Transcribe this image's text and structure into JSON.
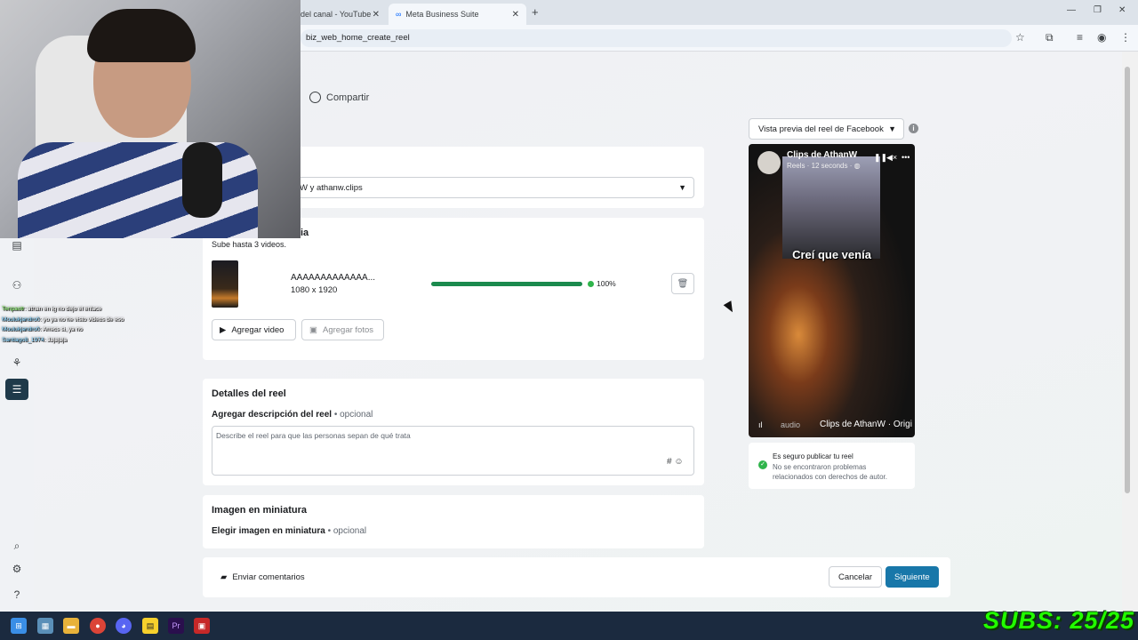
{
  "browser": {
    "tabs": [
      {
        "label": "del canal - YouTube",
        "active": false
      },
      {
        "label": "Meta Business Suite",
        "active": true
      }
    ],
    "url": "biz_web_home_create_reel"
  },
  "steps": {
    "share_label": "Compartir"
  },
  "account_select": {
    "value": "W y athanw.clips"
  },
  "media": {
    "title_fragment": "ia",
    "subtitle": "Sube hasta 3 videos.",
    "video": {
      "name": "AAAAAAAAAAAAA...",
      "dims": "1080 x 1920",
      "progress": 100,
      "progress_label": "100%"
    },
    "add_video_label": "Agregar video",
    "add_photos_label": "Agregar fotos"
  },
  "details": {
    "title": "Detalles del reel",
    "desc_label": "Agregar descripción del reel",
    "optional": "opcional",
    "desc_placeholder": "Describe el reel para que las personas sepan de qué trata"
  },
  "thumbnail": {
    "title": "Imagen en miniatura",
    "choose_label": "Elegir imagen en miniatura",
    "optional": "opcional"
  },
  "preview": {
    "select_label": "Vista previa del reel de Facebook",
    "page_name": "Clips de AthanW",
    "meta": "Reels · 12 seconds · ",
    "caption": "Creí que venía",
    "audio_label": "audio",
    "track_label": "Clips de AthanW · Origi"
  },
  "safety": {
    "title": "Es seguro publicar tu reel",
    "body": "No se encontraron problemas relacionados con derechos de autor."
  },
  "footer": {
    "feedback_label": "Enviar comentarios",
    "cancel_label": "Cancelar",
    "next_label": "Siguiente"
  },
  "chat": [
    {
      "user": "Tenpaotr",
      "msg": ": athan en ig no dejo el enlace"
    },
    {
      "user": "Moulukjandro0",
      "msg": ": yo ya no he visto videos de eso"
    },
    {
      "user": "Moulukjandro0",
      "msg": ": Arrecs si, ya no"
    },
    {
      "user": "Santiago8_1974",
      "msg": ": Jajajaja"
    }
  ],
  "overlay": {
    "subs": "SUBS: 25/25"
  },
  "colors": {
    "primary": "#1877a9",
    "progress": "#1b8a4d",
    "success": "#2fb44b"
  }
}
